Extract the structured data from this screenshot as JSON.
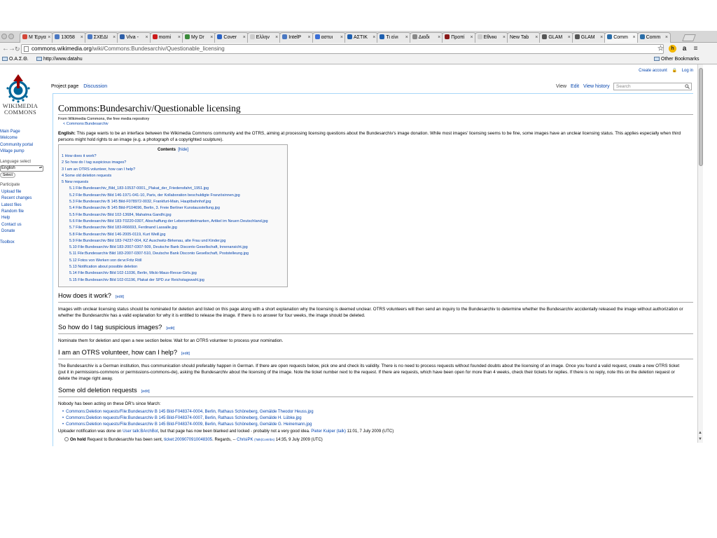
{
  "browser": {
    "tabs": [
      {
        "label": "M Έργα",
        "icon_color": "#d44638"
      },
      {
        "label": "13058",
        "icon_color": "#4a78c2"
      },
      {
        "label": "ΣΧΕΔΙ",
        "icon_color": "#4a78c2"
      },
      {
        "label": "Viva -",
        "icon_color": "#2e5fa8"
      },
      {
        "label": "morni",
        "icon_color": "#cc1a1a"
      },
      {
        "label": "My Dr",
        "icon_color": "#3a8a3a"
      },
      {
        "label": "Cover",
        "icon_color": "#2a62c4"
      },
      {
        "label": "Ελλην",
        "icon_color": "#cccccc"
      },
      {
        "label": "IntelP",
        "icon_color": "#4a78c2"
      },
      {
        "label": "αστυι",
        "icon_color": "#3b6fd6"
      },
      {
        "label": "ΑΣΤΙΚ",
        "icon_color": "#1d5fb0"
      },
      {
        "label": "Τι είνι",
        "icon_color": "#1d5fb0"
      },
      {
        "label": "Διαδι",
        "icon_color": "#888888"
      },
      {
        "label": "Προπί",
        "icon_color": "#8a1a1a"
      },
      {
        "label": "Εθνικι",
        "icon_color": "#cccccc"
      },
      {
        "label": "New Tab",
        "icon_color": ""
      },
      {
        "label": "GLAM",
        "icon_color": "#555555"
      },
      {
        "label": "GLAM",
        "icon_color": "#555555"
      },
      {
        "label": "Comm",
        "icon_color": "#2a6da8",
        "active": true
      },
      {
        "label": "Comm",
        "icon_color": "#2a6da8"
      }
    ],
    "url_host": "commons.wikimedia.org",
    "url_path": "/wiki/Commons:Bundesarchiv/Questionable_licensing",
    "bookmarks": [
      "O.A.Σ.Θ.",
      "http://www.datahu"
    ],
    "other_bookmarks": "Other Bookmarks"
  },
  "wiki": {
    "personal": {
      "create_account": "Create account",
      "log_in": "Log in"
    },
    "logo_text": [
      "WIKIMEDIA",
      "COMMONS"
    ],
    "sidebar": {
      "nav": [
        "Main Page",
        "Welcome",
        "Community portal",
        "Village pump"
      ],
      "language_heading": "Language select",
      "language_value": "English",
      "select_button": "Select",
      "participate_heading": "Participate",
      "participate": [
        "Upload file",
        "Recent changes",
        "Latest files",
        "Random file",
        "Help",
        "Contact us",
        "Donate"
      ],
      "toolbox": "Toolbox"
    },
    "tabs": {
      "project_page": "Project page",
      "discussion": "Discussion",
      "view": "View",
      "edit": "Edit",
      "view_history": "View history",
      "search_placeholder": "Search"
    },
    "title": "Commons:Bundesarchiv/Questionable licensing",
    "site_sub": "From Wikimedia Commons, the free media repository",
    "content_sub": "< Commons:Bundesarchiv",
    "intro_label": "English:",
    "intro": " This page wants to be an interface between the Wikimedia Commons community and the OTRS, aiming at processing licensing questions about the Bundesarchiv's image donation. While most images' licensing seems to be fine, some images have an unclear licensing status. This applies especially when third persons might hold rights to an image (e.g. a photograph of a copyrighted sculpture).",
    "toc": {
      "title": "Contents",
      "hide": "[hide]",
      "items": [
        {
          "text": "1 How does it work?",
          "level": 1
        },
        {
          "text": "2 So how do I tag suspicious images?",
          "level": 1
        },
        {
          "text": "3 I am an OTRS volunteer, how can I help?",
          "level": 1
        },
        {
          "text": "4 Some old deletion requests",
          "level": 1
        },
        {
          "text": "5 New requests",
          "level": 1
        },
        {
          "text": "5.1 File:Bundesarchiv_Bild_183-10537-0001,_Plakat_der_Friedensfahrt_1951.jpg",
          "level": 2
        },
        {
          "text": "5.2 File:Bundesarchiv Bild 146-1971-041-10, Paris, der Kollaboration beschuldigte Französinnen.jpg",
          "level": 2
        },
        {
          "text": "5.3 File:Bundesarchiv B 145 Bild-F078972-0032, Frankfurt-Main, Hauptbahnhof.jpg",
          "level": 2
        },
        {
          "text": "5.4 File:Bundesarchiv B 145 Bild-P104696, Berlin, 3. Freie Berliner Kunstausstellung.jpg",
          "level": 2
        },
        {
          "text": "5.5 File:Bundesarchiv Bild 102-13684, Mahatma Gandhi.jpg",
          "level": 2
        },
        {
          "text": "5.6 File:Bundesarchiv Bild 183-T0220-0307, Abschaffung der Lebensmittelmarken, Artikel im Neuen Deutschland.jpg",
          "level": 2
        },
        {
          "text": "5.7 File:Bundesarchiv Bild 183-R66693, Ferdinand Lassalle.jpg",
          "level": 2
        },
        {
          "text": "5.8 File:Bundesarchiv Bild 146-2005-0119, Kurt Weill.jpg",
          "level": 2
        },
        {
          "text": "5.9 File:Bundesarchiv Bild 183-74237-004, KZ Auschwitz-Birkenau, alte Frau und Kinder.jpg",
          "level": 2
        },
        {
          "text": "5.10 File:Bundesarchiv Bild 183-2007-0307-509, Deutsche Bank Disconto Gesellschaft, Innenansicht.jpg",
          "level": 2
        },
        {
          "text": "5.11 File:Bundesarchiv Bild 183-2007-0307-510, Deutsche Bank Disconto Gesellschaft, Poststelleung.jpg",
          "level": 2
        },
        {
          "text": "5.12 Fotos von Werken von de:w:Fritz Röll",
          "level": 2
        },
        {
          "text": "5.13 Notification about possible deletion",
          "level": 2
        },
        {
          "text": "5.14 File:Bundesarchiv Bild 102-11036, Berlin, Micki-Maus-Revue-Girls.jpg",
          "level": 2
        },
        {
          "text": "5.15 File:Bundesarchiv Bild 102-01196, Plakat der SPD zur Reichstagswahl.jpg",
          "level": 2
        }
      ]
    },
    "edit_label": "[edit]",
    "sections": {
      "how": {
        "heading": "How does it work?",
        "text": "Images with unclear licensing status should be nominated for deletion and listed on this page along with a short explanation why the licensing is deemed unclear. OTRS volunteers will then send an inquiry to the Bundesarchiv to determine whether the Bundesarchiv accidentally released the image without authorization or whether the Bundesarchiv has a valid explanation for why it is entitled to release the image. If there is no answer for four weeks, the image should be deleted."
      },
      "tag": {
        "heading": "So how do I tag suspicious images?",
        "text": "Nominate them for deletion and open a new section below. Wait for an OTRS volunteer to process your nomination."
      },
      "otrs": {
        "heading": "I am an OTRS volunteer, how can I help?",
        "text": "The Bundesarchiv is a German institution, thus communication should preferably happen in German. If there are open requests below, pick one and check its validity. There is no need to process requests without founded doubts about the licensing of an image. Once you found a valid request, create a new OTRS ticket (put it in permissions-commons or permissions-commons-de), asking the Bundesarchiv about the licensing of the image. Note the ticket number next to the request. If there are requests, which have been open for more than 4 weeks, check their tickets for replies. If there is no reply, note this on the deletion request or delete the image right away."
      },
      "old": {
        "heading": "Some old deletion requests",
        "intro": "Nobody has been acting on these DR's since March:",
        "links": [
          "Commons:Deletion requests/File:Bundesarchiv B 145 Bild-F048374-0004, Berlin, Rathaus Schöneberg, Gemälde Theodor Heuss.jpg",
          "Commons:Deletion requests/File:Bundesarchiv B 145 Bild-F048374-0007, Berlin, Rathaus Schöneberg, Gemälde H. Lübke.jpg",
          "Commons:Deletion requests/File:Bundesarchiv B 145 Bild-F048374-0009, Berlin, Rathaus Schöneberg, Gemälde G. Heinemann.jpg"
        ],
        "uploader_pre": "Uploader notification was done on ",
        "uploader_link": "User talk:BArchBot",
        "uploader_mid": ", but that page has now been blanked and locked - probably not a very good idea. ",
        "uploader_sig": "Pieter Kuiper",
        "uploader_talk": "(talk)",
        "uploader_time": " 11:01, 7 July 2009 (UTC)",
        "hold_label": "On hold",
        "hold_text": " Request to Bundesarchiv has been sent, ",
        "hold_ticket": "ticket:2009070910048305",
        "hold_regards": ". Regards, -- ",
        "hold_sig": "ChrisiPK",
        "hold_contribs": "(Talk|Contribs)",
        "hold_time": " 14:35, 9 July 2009 (UTC)"
      }
    }
  }
}
